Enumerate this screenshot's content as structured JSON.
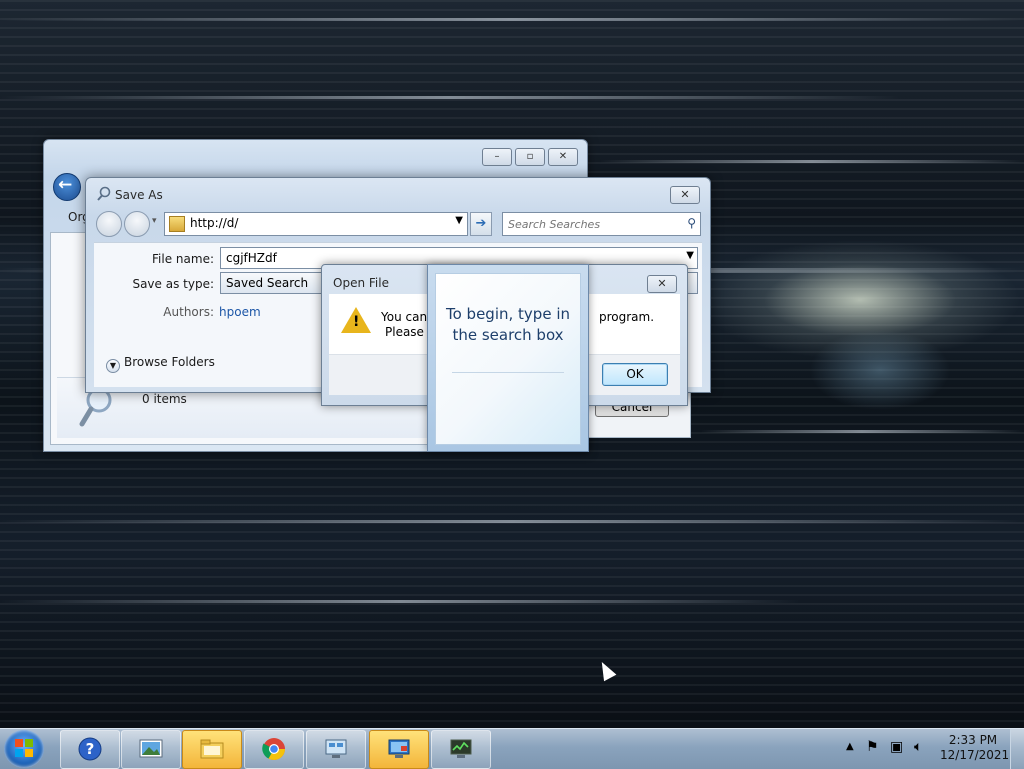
{
  "save_as": {
    "title": "Save As",
    "address": "http://d/",
    "search_placeholder": "Search Searches",
    "file_name_label": "File name:",
    "file_name_value": "cgjfHZdf",
    "save_type_label": "Save as type:",
    "save_type_value": "Saved Search",
    "authors_label": "Authors:",
    "authors_value": "hpoem",
    "browse_folders": "Browse Folders",
    "cancel_label": "Cancel"
  },
  "explorer": {
    "organize_label": "Org",
    "items_count": "0 items"
  },
  "open_file": {
    "title": "Open File",
    "message_line1": "You can'",
    "message_line1_end": "program.",
    "message_line2": "Please tr",
    "ok_label": "OK"
  },
  "search_tip": {
    "text": "To begin, type in the search box"
  },
  "taskbar": {
    "time": "2:33 PM",
    "date": "12/17/2021",
    "buttons": [
      "help-icon",
      "pictures-icon",
      "explorer-folder-icon",
      "chrome-icon",
      "remote-desktop-icon",
      "display-settings-icon",
      "system-monitor-icon"
    ]
  },
  "colors": {
    "link": "#1c56a7",
    "active_taskbar": "#f3b53a",
    "tip_text": "#1e3f6b"
  }
}
